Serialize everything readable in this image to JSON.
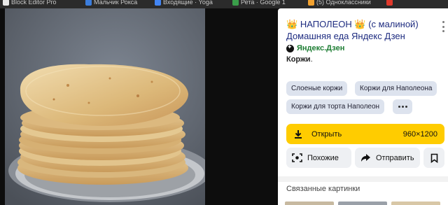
{
  "bookmarks": [
    {
      "label": "Block Editor Pro",
      "color": "#e8e8e8"
    },
    {
      "label": "Мальчик Рокса",
      "color": "#3b7ddd"
    },
    {
      "label": "Входящие · Yoga",
      "color": "#4285f4"
    },
    {
      "label": "Рета · Google 1",
      "color": "#3a9e4a"
    },
    {
      "label": "(5) Одноклассники",
      "color": "#f2a12f"
    },
    {
      "label": "",
      "color": "#e0382b"
    }
  ],
  "panel": {
    "title_line1_crown": "👑",
    "title_line1_text": "НАПОЛЕОН",
    "title_line1_crown2": "👑",
    "title_line1_suffix": "(с малиной)",
    "title_line2": "Домашняя еда Яндекс Дзен",
    "source_name": "Яндекс.Дзен",
    "description": "Коржи",
    "description_suffix": ".",
    "tags": [
      "Слоеные коржи",
      "Коржи для Наполеона",
      "Коржи для торта Наполеон"
    ],
    "open_label": "Открыть",
    "resolution": "960×1200",
    "similar_label": "Похожие",
    "share_label": "Отправить",
    "related_title": "Связанные картинки"
  },
  "icons": {
    "more": "more-vertical-icon",
    "download": "download-icon",
    "lens": "lens-icon",
    "share": "share-arrow-icon",
    "bookmark": "bookmark-icon",
    "source": "dzen-icon"
  },
  "colors": {
    "title": "#1e2c80",
    "source": "#1e7e34",
    "accent": "#ffcc00",
    "tag_bg": "#dde3ee"
  }
}
